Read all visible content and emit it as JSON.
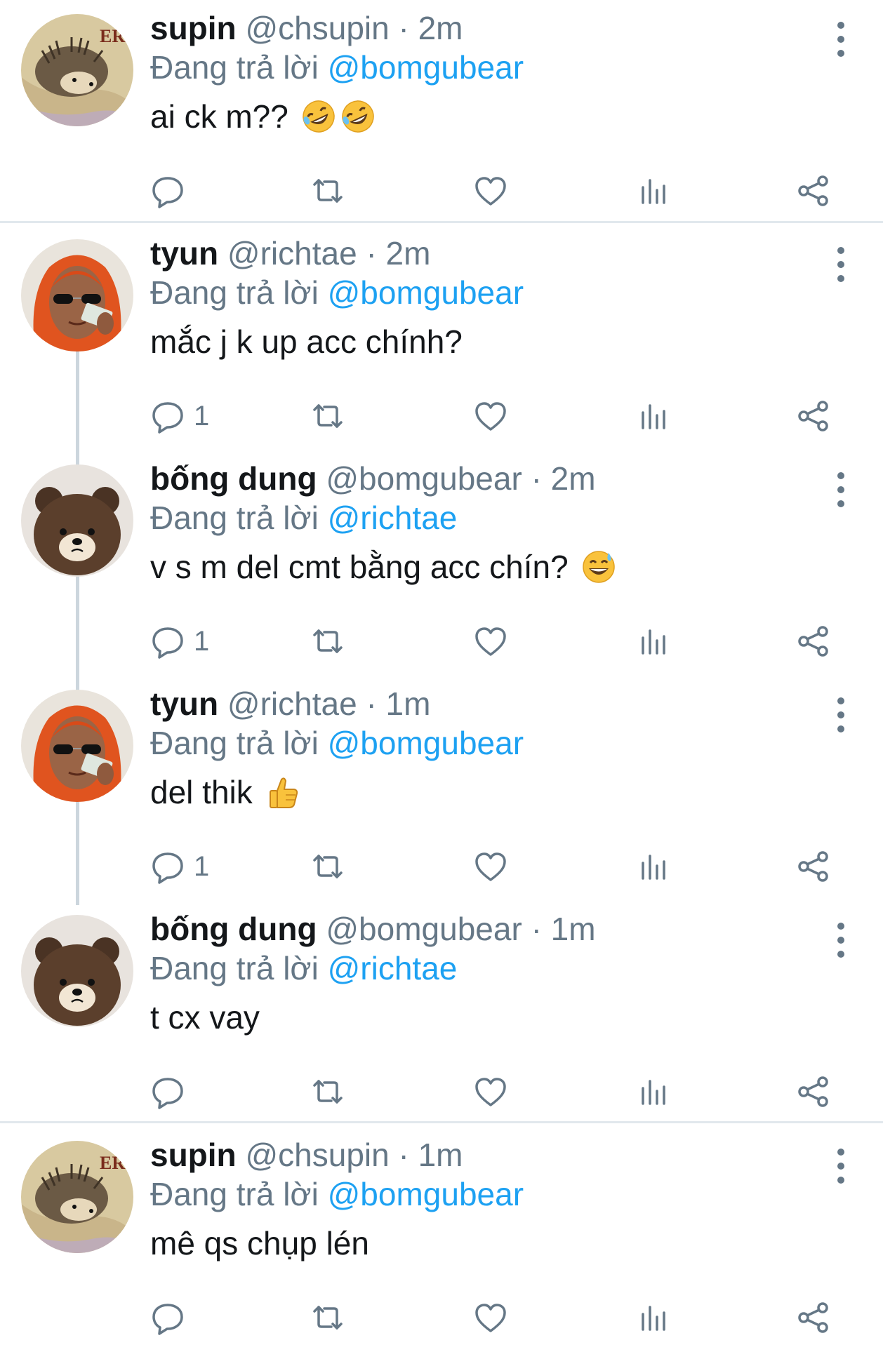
{
  "reply_prefix": "Đang trả lời",
  "separator": "·",
  "colors": {
    "mention": "#1da1f2",
    "muted": "#657786",
    "text": "#14171a",
    "divider": "#e1e8ed",
    "thread_line": "#ccd6dd"
  },
  "tweets": [
    {
      "name": "supin",
      "handle": "@chsupin",
      "time": "2m",
      "reply_to": "@bomgubear",
      "text": "ai ck m??",
      "emojis": [
        "rofl-emoji",
        "rofl-emoji"
      ],
      "avatar": "hedgehog-avatar",
      "reply_count": ""
    },
    {
      "name": "tyun",
      "handle": "@richtae",
      "time": "2m",
      "reply_to": "@bomgubear",
      "text": "mắc j k up acc chính?",
      "emojis": [],
      "avatar": "orange-hair-woman-avatar",
      "reply_count": "1"
    },
    {
      "name": "bống dung",
      "handle": "@bomgubear",
      "time": "2m",
      "reply_to": "@richtae",
      "text": "v s m del cmt bằng acc chín?",
      "emojis": [
        "grinning-sweat-emoji"
      ],
      "avatar": "brown-bear-avatar",
      "reply_count": "1"
    },
    {
      "name": "tyun",
      "handle": "@richtae",
      "time": "1m",
      "reply_to": "@bomgubear",
      "text": "del thik",
      "emojis": [
        "thumbs-up-emoji"
      ],
      "avatar": "orange-hair-woman-avatar",
      "reply_count": "1"
    },
    {
      "name": "bống dung",
      "handle": "@bomgubear",
      "time": "1m",
      "reply_to": "@richtae",
      "text": "t cx vay",
      "emojis": [],
      "avatar": "brown-bear-avatar",
      "reply_count": ""
    },
    {
      "name": "supin",
      "handle": "@chsupin",
      "time": "1m",
      "reply_to": "@bomgubear",
      "text": "mê qs chụp lén",
      "emojis": [],
      "avatar": "hedgehog-avatar",
      "reply_count": ""
    }
  ]
}
